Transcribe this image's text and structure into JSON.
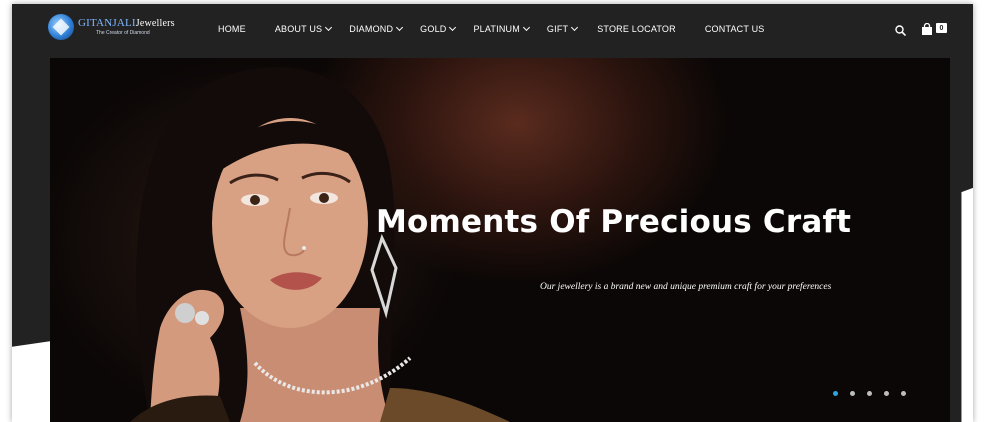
{
  "brand": {
    "name_main": "GITANJALI",
    "name_suffix": "Jewellers",
    "tagline": "The Creator of Diamond",
    "logo_icon": "diamond-globe-icon"
  },
  "nav": {
    "items": [
      {
        "label": "HOME",
        "has_dropdown": false
      },
      {
        "label": "ABOUT US",
        "has_dropdown": true
      },
      {
        "label": "DIAMOND",
        "has_dropdown": true
      },
      {
        "label": "GOLD",
        "has_dropdown": true
      },
      {
        "label": "PLATINUM",
        "has_dropdown": true
      },
      {
        "label": "GIFT",
        "has_dropdown": true
      },
      {
        "label": "STORE LOCATOR",
        "has_dropdown": false
      },
      {
        "label": "CONTACT US",
        "has_dropdown": false
      }
    ]
  },
  "header_icons": {
    "search": "search-icon",
    "cart": "shopping-bag-icon",
    "cart_count": "0"
  },
  "hero": {
    "title": "Moments Of Precious Craft",
    "subtitle": "Our jewellery is a brand new and unique premium craft for your preferences",
    "slide_count": 5,
    "active_slide": 1
  },
  "colors": {
    "header_bg": "#222222",
    "accent": "#2aa6e0",
    "text": "#ffffff"
  }
}
